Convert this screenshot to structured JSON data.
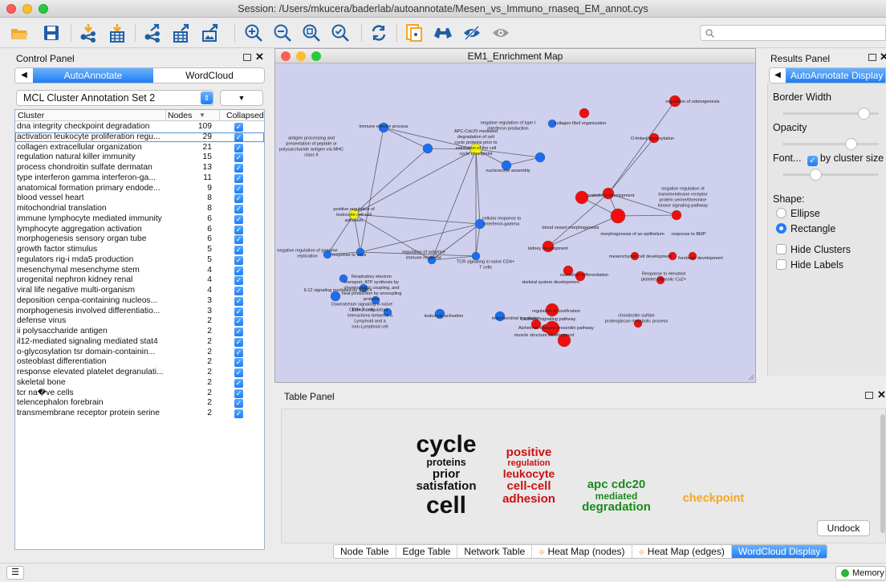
{
  "window": {
    "title": "Session: /Users/mkucera/baderlab/autoannotate/Mesen_vs_Immuno_rnaseq_EM_annot.cys"
  },
  "toolbar": {
    "icons": [
      "open-session-icon",
      "save-session-icon",
      "import-network-icon",
      "import-table-icon",
      "export-network-icon",
      "export-table-icon",
      "export-image-icon",
      "zoom-in-icon",
      "zoom-out-icon",
      "zoom-fit-icon",
      "zoom-selected-icon",
      "refresh-icon",
      "new-network-from-selection-icon",
      "first-neighbors-icon",
      "hide-selected-icon",
      "show-all-icon"
    ],
    "search_placeholder": ""
  },
  "control_panel": {
    "title": "Control Panel",
    "tabs": [
      {
        "label": "AutoAnnotate",
        "selected": true
      },
      {
        "label": "WordCloud",
        "selected": false
      }
    ],
    "annotation_set": "MCL Cluster Annotation Set 2",
    "columns": {
      "cluster": "Cluster",
      "nodes": "Nodes",
      "collapsed": "Collapsed"
    },
    "rows": [
      {
        "cluster": "dna integrity checkpoint degradation",
        "nodes": "109"
      },
      {
        "cluster": "activation leukocyte proliferation regu...",
        "nodes": "29"
      },
      {
        "cluster": "collagen extracellular organization",
        "nodes": "21"
      },
      {
        "cluster": "regulation natural killer immunity",
        "nodes": "15"
      },
      {
        "cluster": "process chondroitin sulfate dermatan",
        "nodes": "13"
      },
      {
        "cluster": "type interferon gamma interferon-ga...",
        "nodes": "11"
      },
      {
        "cluster": "anatomical formation primary endode...",
        "nodes": "9"
      },
      {
        "cluster": "blood vessel heart",
        "nodes": "8"
      },
      {
        "cluster": "mitochondrial translation",
        "nodes": "8"
      },
      {
        "cluster": "immune lymphocyte mediated immunity",
        "nodes": "6"
      },
      {
        "cluster": "lymphocyte aggregation activation",
        "nodes": "6"
      },
      {
        "cluster": "morphogenesis sensory organ tube",
        "nodes": "6"
      },
      {
        "cluster": "growth factor stimulus",
        "nodes": "5"
      },
      {
        "cluster": "regulators rig-i mda5 production",
        "nodes": "5"
      },
      {
        "cluster": "mesenchymal mesenchyme stem",
        "nodes": "4"
      },
      {
        "cluster": "urogenital nephron kidney renal",
        "nodes": "4"
      },
      {
        "cluster": "viral life negative multi-organism",
        "nodes": "4"
      },
      {
        "cluster": "deposition cenpa-containing nucleos...",
        "nodes": "3"
      },
      {
        "cluster": "morphogenesis involved differentiatio...",
        "nodes": "3"
      },
      {
        "cluster": "defense virus",
        "nodes": "2"
      },
      {
        "cluster": "ii polysaccharide antigen",
        "nodes": "2"
      },
      {
        "cluster": "il12-mediated signaling mediated stat4",
        "nodes": "2"
      },
      {
        "cluster": "o-glycosylation tsr domain-containin...",
        "nodes": "2"
      },
      {
        "cluster": "osteoblast differentiation",
        "nodes": "2"
      },
      {
        "cluster": "response elevated platelet degranulati...",
        "nodes": "2"
      },
      {
        "cluster": "skeletal bone",
        "nodes": "2"
      },
      {
        "cluster": "tcr na�ve cells",
        "nodes": "2"
      },
      {
        "cluster": "telencephalon forebrain",
        "nodes": "2"
      },
      {
        "cluster": "transmembrane receptor protein serine",
        "nodes": "2"
      }
    ]
  },
  "network": {
    "title": "EM1_Enrichment Map",
    "labels": [
      "regulation of odonogenesis",
      "immune effector process",
      "negative regulation of type I interferon production",
      "collagen fibril organization",
      "O-linked glycosylation",
      "antigen processing and presentation of peptide or polysaccharide antigen via MHC class II",
      "APC-Cdc20 mediated degradation of cell cycle proteins prior to satisfation of the cell cycle checkpoint",
      "nucleosome assembly",
      "endoderm development",
      "negative regulation of transmembrane receptor protein serine/threonine kinase signaling pathway",
      "positive regulation of leukocyte cell-cell adhesion",
      "cellular response to interferon-gamma",
      "blood vessel morphogenesis",
      "morphogenesis of an epithelium",
      "response to BMP",
      "kidney development",
      "negative regulation of genome replication",
      "response to virus",
      "regulation of adaptive immune response",
      "TCR signaling in naïve CD4+ T cells",
      "mesenchymal cell development",
      "forebrain development",
      "osteoblast differentiation",
      "skeletal system development",
      "Response to elevated platelet cytosolic Ca2+",
      "IL12 signaling mediated by STAT4",
      "Respiratory electron transport, ATP synthesis by chemiosmotic coupling, and heat production by uncoupling proteins",
      "Downstream signaling in naïve CD8+ T cells",
      "Immunoregulatory interactions between a Lymphoid and a non-Lymphoid cell",
      "leukocyte activation",
      "mitochondrial translation",
      "regulation of ossification",
      "Cadherin signaling pathway",
      "Alzheimer disease-presenilin pathway",
      "muscle structure development",
      "chondroitin sulfate proteoglycan metabolic process"
    ]
  },
  "results_panel": {
    "title": "Results Panel",
    "tab_label": "AutoAnnotate Display",
    "border_width_label": "Border Width",
    "border_width_value": 0.85,
    "opacity_label": "Opacity",
    "opacity_value": 0.72,
    "font_label": "Font...",
    "by_cluster_size_label": "by cluster size",
    "font_value": 0.35,
    "shape_label": "Shape:",
    "shape_options": [
      "Ellipse",
      "Rectangle"
    ],
    "shape_selected": "Rectangle",
    "hide_clusters_label": "Hide Clusters",
    "hide_labels_label": "Hide Labels"
  },
  "table_panel": {
    "title": "Table Panel",
    "undock_label": "Undock",
    "wordcloud": {
      "black": [
        "cycle",
        "proteins",
        "prior",
        "satisfation",
        "cell"
      ],
      "red": [
        "positive",
        "regulation",
        "leukocyte",
        "cell-cell",
        "adhesion"
      ],
      "green": [
        "apc  cdc20",
        "mediated",
        "degradation"
      ],
      "orange": [
        "checkpoint"
      ]
    },
    "tabs": [
      "Node Table",
      "Edge Table",
      "Network Table",
      "Heat Map (nodes)",
      "Heat Map (edges)",
      "WordCloud Display"
    ],
    "selected_tab": "WordCloud Display"
  },
  "statusbar": {
    "memory_label": "Memory"
  },
  "colors": {
    "accent": "#1e7ef5",
    "node_red": "#f20d0d",
    "node_blue": "#1a6ef0",
    "node_yellow": "#f2f20d",
    "network_bg": "#cfd0ee",
    "wc_red": "#cc1111",
    "wc_green": "#1a8a1a",
    "wc_orange": "#f5a623"
  }
}
